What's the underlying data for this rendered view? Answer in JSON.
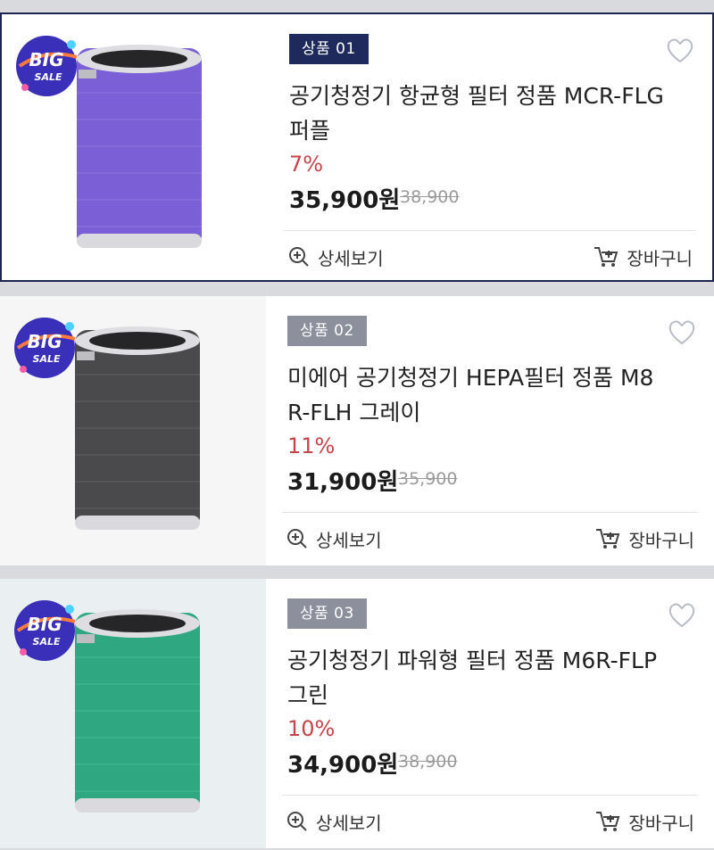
{
  "badge": {
    "line1": "BIG",
    "line2": "SALE"
  },
  "detail_label": "상세보기",
  "cart_label": "장바구니",
  "products": [
    {
      "tag": "상품 01",
      "title": "공기청정기 항균형 필터 정품 MCR-FLG 퍼플",
      "discount": "7%",
      "price": "35,900원",
      "original_price": "38,900",
      "filter_color": "#7a5fd6",
      "image_name": "purple-filter-image"
    },
    {
      "tag": "상품 02",
      "title": "미에어 공기청정기 HEPA필터 정품 M8R-FLH 그레이",
      "discount": "11%",
      "price": "31,900원",
      "original_price": "35,900",
      "filter_color": "#4a4a4c",
      "image_name": "gray-filter-image"
    },
    {
      "tag": "상품 03",
      "title": "공기청정기 파워형 필터 정품 M6R-FLP 그린",
      "discount": "10%",
      "price": "34,900원",
      "original_price": "38,900",
      "filter_color": "#2fa882",
      "image_name": "green-filter-image"
    }
  ],
  "colors": {
    "accent_tag": "#1f2a5c",
    "tag_gray": "#8c8f9c",
    "discount_red": "#c8434a",
    "selected_border": "#1f2550"
  }
}
